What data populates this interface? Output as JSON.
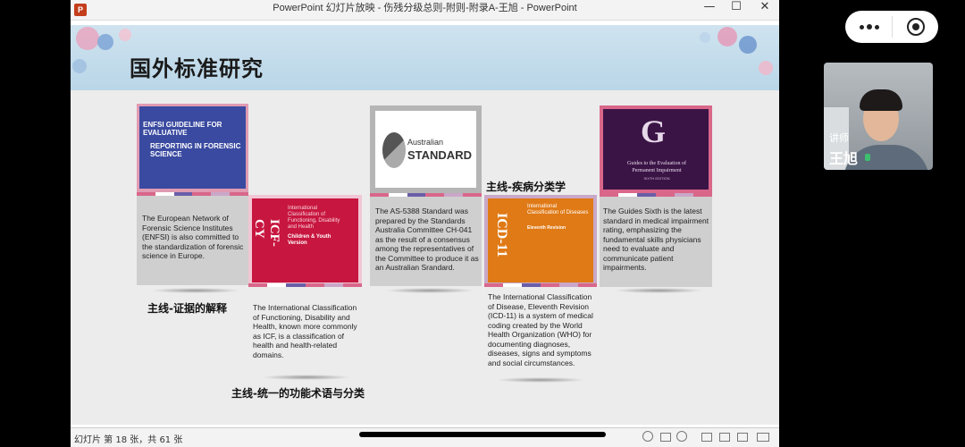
{
  "window": {
    "title": "PowerPoint 幻灯片放映 - 伤残分级总则-附则-附录A-王旭 - PowerPoint",
    "app_icon": "P",
    "minimize": "—",
    "maximize": "☐",
    "close": "✕"
  },
  "slide": {
    "title": "国外标准研究",
    "cards": {
      "enfsi": {
        "cover_line1": "ENFSI GUIDELINE FOR EVALUATIVE",
        "cover_line2": "REPORTING IN FORENSIC SCIENCE",
        "text": "The European Network of Forensic Science Institutes (ENFSI) is also committed to the standardization of forensic science in Europe."
      },
      "icf": {
        "cover_title": "ICF-CY",
        "cover_sub": "International Classification of Functioning, Disability and Health",
        "cover_sub2": "Children & Youth Version",
        "text": "The International Classification of Functioning, Disability and Health, known more commonly as ICF, is a classification of health and health-related domains."
      },
      "as": {
        "logo_line1": "Australian",
        "logo_line2": "STANDARD",
        "text": "The AS-5388 Standard was prepared by the Standards Australia Committee CH-041 as the result of a consensus among the representatives of the Committee to produce it as an Australian Srandard."
      },
      "icd": {
        "cover_title": "ICD-11",
        "cover_sub": "International Classification of Diseases",
        "cover_sub2": "Eleventh Revision",
        "text": "The International Classification of Disease, Eleventh Revision (ICD-11) is a system of medical coding created by the World Health Organization (WHO) for documenting diagnoses, diseases, signs and symptoms and social circumstances."
      },
      "guides": {
        "cover_letter": "G",
        "cover_line1": "Guides to the Evaluation of",
        "cover_line2": "Permanent Impairment",
        "cover_line3": "SIXTH EDITION",
        "text": "The Guides Sixth is the latest standard in medical impairment rating, emphasizing the fundamental skills physicians need to evaluate and communicate patient impairments."
      }
    },
    "labels": {
      "evidence": "主线-证据的解释",
      "functional": "主线-统一的功能术语与分类",
      "disease": "主线-疾病分类学"
    }
  },
  "status": {
    "slide_counter": "幻灯片 第 18 张，共 61 张"
  },
  "presenter": {
    "role": "讲师",
    "name": "王旭"
  },
  "colors": {
    "accent_pink": "#d9678a",
    "enfsi_blue": "#3a4aa0",
    "icf_red": "#c7163f",
    "icd_orange": "#e07a16",
    "guides_purple": "#3b1446"
  }
}
